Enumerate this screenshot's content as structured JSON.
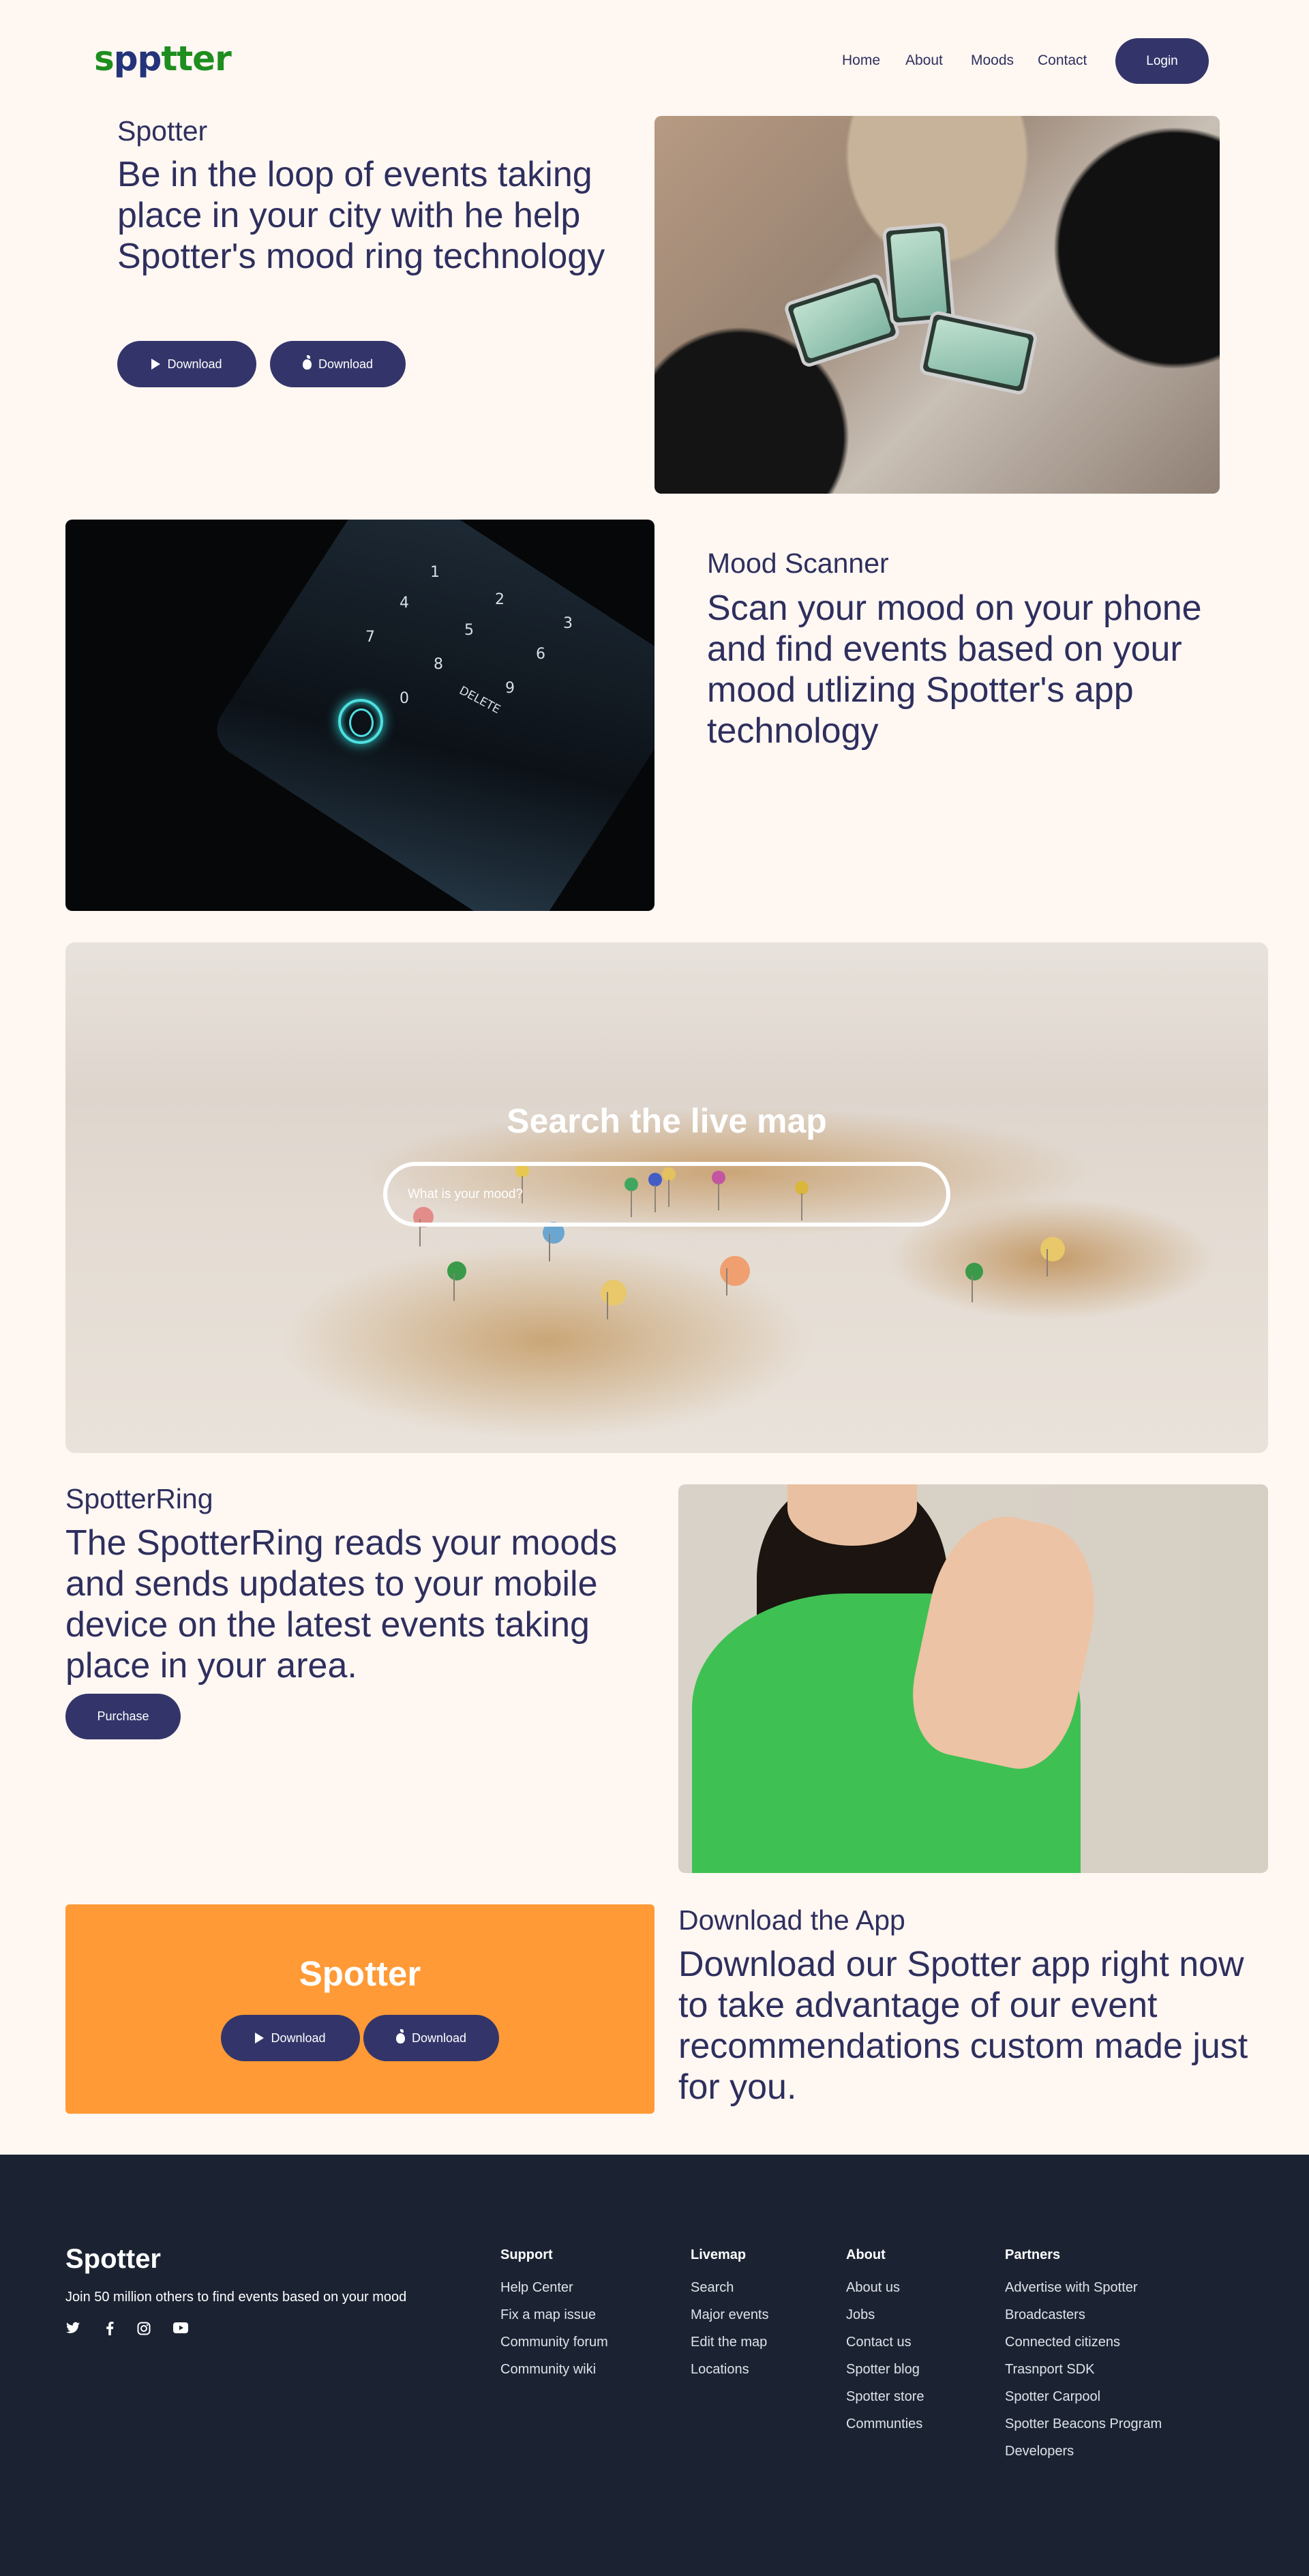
{
  "header": {
    "logo_text_a": "s",
    "logo_text_b": "pp",
    "logo_text_c": "tter",
    "nav": [
      "Home",
      "About",
      "Moods",
      "Contact"
    ],
    "login_label": "Login"
  },
  "hero": {
    "eyebrow": "Spotter",
    "headline": "Be in the loop of events taking place in your city with he help Spotter's mood ring technology",
    "buttons": [
      {
        "label": "Download",
        "icon": "play-store-icon"
      },
      {
        "label": "Download",
        "icon": "apple-icon"
      }
    ]
  },
  "scanner": {
    "eyebrow": "Mood Scanner",
    "headline": "Scan your mood on your phone and find events based on your mood utlizing Spotter's app technology",
    "keypad": [
      "1",
      "2",
      "3",
      "4",
      "5",
      "6",
      "7",
      "8",
      "9",
      "0",
      "DELETE"
    ]
  },
  "map": {
    "title": "Search the live map",
    "search_placeholder": "What is your mood?"
  },
  "ring": {
    "eyebrow": "SpotterRing",
    "headline": "The SpotterRing reads your moods and sends updates to your mobile device on the latest events taking place in your area.",
    "purchase_label": "Purchase"
  },
  "download": {
    "card_title": "Spotter",
    "buttons": [
      {
        "label": "Download",
        "icon": "play-store-icon"
      },
      {
        "label": "Download",
        "icon": "apple-icon"
      }
    ],
    "eyebrow": "Download the App",
    "headline": "Download our Spotter app right now to take advantage of our event recommendations custom made just for you.",
    "card_color": "#ff9a36"
  },
  "footer": {
    "brand": "Spotter",
    "tagline": "Join 50 million others to find events based on your mood",
    "social_icons": [
      "twitter-icon",
      "facebook-icon",
      "instagram-icon",
      "youtube-icon"
    ],
    "columns": [
      {
        "title": "Support",
        "items": [
          "Help Center",
          "Fix a map issue",
          "Community forum",
          "Community wiki"
        ]
      },
      {
        "title": "Livemap",
        "items": [
          "Search",
          "Major events",
          "Edit the map",
          "Locations"
        ]
      },
      {
        "title": "About",
        "items": [
          "About us",
          "Jobs",
          "Contact us",
          "Spotter blog",
          "Spotter store",
          "Communties"
        ]
      },
      {
        "title": "Partners",
        "items": [
          "Advertise with Spotter",
          "Broadcasters",
          "Connected citizens",
          "Trasnport SDK",
          "Spotter Carpool",
          "Spotter Beacons Program",
          "Developers"
        ]
      }
    ],
    "bg_color": "#1b2333"
  },
  "colors": {
    "primary": "#33356a",
    "background": "#fff7f2",
    "logo_green": "#1e8e1e",
    "logo_blue": "#24347a"
  }
}
